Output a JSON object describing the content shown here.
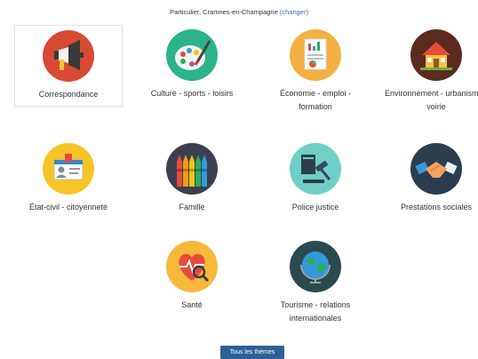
{
  "context": {
    "text": "Particulier, Cramnes-en-Champagne",
    "change_label": "(changer)"
  },
  "themes": [
    {
      "label": "Correspondance",
      "icon": "megaphone-icon",
      "selected": true
    },
    {
      "label": "Culture - sports - loisirs",
      "icon": "palette-icon"
    },
    {
      "label": "Économie - emploi - formation",
      "icon": "chart-document-icon"
    },
    {
      "label": "Environnement - urbanisme - voirie",
      "icon": "house-icon"
    },
    {
      "label": "État-civil - citoyenneté",
      "icon": "id-card-icon"
    },
    {
      "label": "Famille",
      "icon": "crayons-icon"
    },
    {
      "label": "Police justice",
      "icon": "gavel-icon"
    },
    {
      "label": "Prestations sociales",
      "icon": "handshake-icon"
    },
    {
      "label": "Santé",
      "icon": "heart-stethoscope-icon"
    },
    {
      "label": "Tourisme - relations internationales",
      "icon": "globe-icon"
    }
  ],
  "all_themes_button": "Tous les thèmes",
  "colors": {
    "link": "#2f6fb3",
    "button_bg": "#2f5f97",
    "megaphone_bg": "#d84a34",
    "palette_bg": "#2bb38a",
    "chart_bg": "#f4b042",
    "house_bg": "#5a2b1e",
    "idcard_bg": "#f6c427",
    "crayons_bg": "#3c3f4f",
    "gavel_bg": "#6fcfc7",
    "handshake_bg": "#2b3e50",
    "heart_bg": "#f6b93b",
    "globe_bg": "#2b4a4f"
  }
}
